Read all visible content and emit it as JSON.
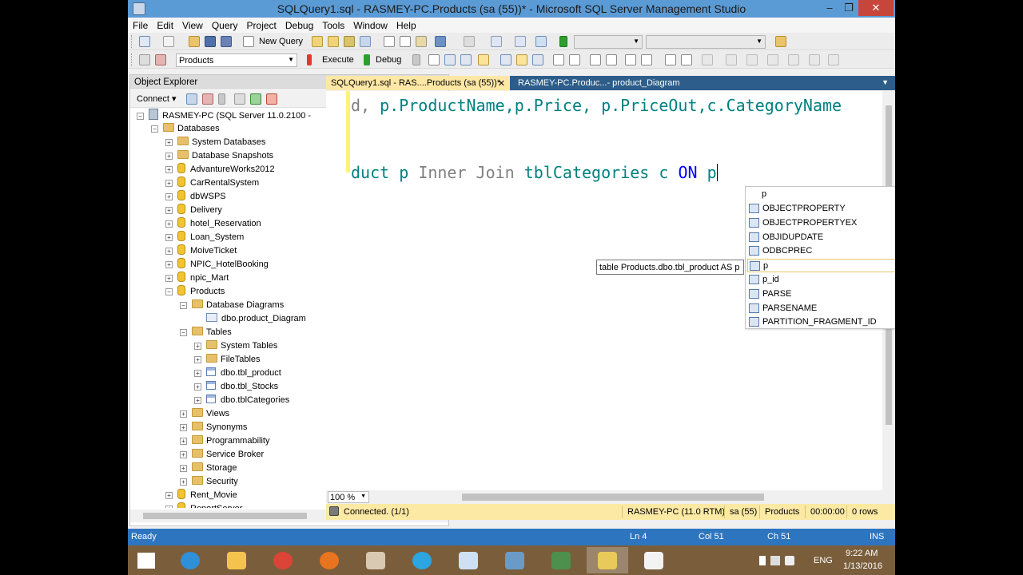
{
  "window": {
    "title": "SQLQuery1.sql - RASMEY-PC.Products (sa (55))* - Microsoft SQL Server Management Studio",
    "minimize": "–",
    "maximize": "❐",
    "close": "✕"
  },
  "menu": [
    "File",
    "Edit",
    "View",
    "Query",
    "Project",
    "Debug",
    "Tools",
    "Window",
    "Help"
  ],
  "toolbar1": {
    "new_query": "New Query"
  },
  "toolbar2": {
    "database": "Products",
    "execute": "Execute",
    "debug": "Debug"
  },
  "object_explorer": {
    "title": "Object Explorer",
    "pins": "▾ ⊥ ✕",
    "connect": "Connect ▾",
    "tree": [
      {
        "label": "RASMEY-PC (SQL Server 11.0.2100 -",
        "level": 0,
        "exp": "−",
        "icon": "server"
      },
      {
        "label": "Databases",
        "level": 1,
        "exp": "−",
        "icon": "folder"
      },
      {
        "label": "System Databases",
        "level": 2,
        "exp": "+",
        "icon": "folder"
      },
      {
        "label": "Database Snapshots",
        "level": 2,
        "exp": "+",
        "icon": "folder"
      },
      {
        "label": "AdvantureWorks2012",
        "level": 2,
        "exp": "+",
        "icon": "db"
      },
      {
        "label": "CarRentalSystem",
        "level": 2,
        "exp": "+",
        "icon": "db"
      },
      {
        "label": "dbWSPS",
        "level": 2,
        "exp": "+",
        "icon": "db"
      },
      {
        "label": "Delivery",
        "level": 2,
        "exp": "+",
        "icon": "db"
      },
      {
        "label": "hotel_Reservation",
        "level": 2,
        "exp": "+",
        "icon": "db"
      },
      {
        "label": "Loan_System",
        "level": 2,
        "exp": "+",
        "icon": "db"
      },
      {
        "label": "MoiveTicket",
        "level": 2,
        "exp": "+",
        "icon": "db"
      },
      {
        "label": "NPIC_HotelBooking",
        "level": 2,
        "exp": "+",
        "icon": "db"
      },
      {
        "label": "npic_Mart",
        "level": 2,
        "exp": "+",
        "icon": "db"
      },
      {
        "label": "Products",
        "level": 2,
        "exp": "−",
        "icon": "db"
      },
      {
        "label": "Database Diagrams",
        "level": 3,
        "exp": "−",
        "icon": "folder"
      },
      {
        "label": "dbo.product_Diagram",
        "level": 4,
        "exp": "",
        "icon": "diagram"
      },
      {
        "label": "Tables",
        "level": 3,
        "exp": "−",
        "icon": "folder"
      },
      {
        "label": "System Tables",
        "level": 4,
        "exp": "+",
        "icon": "folder"
      },
      {
        "label": "FileTables",
        "level": 4,
        "exp": "+",
        "icon": "folder"
      },
      {
        "label": "dbo.tbl_product",
        "level": 4,
        "exp": "+",
        "icon": "table"
      },
      {
        "label": "dbo.tbl_Stocks",
        "level": 4,
        "exp": "+",
        "icon": "table"
      },
      {
        "label": "dbo.tblCategories",
        "level": 4,
        "exp": "+",
        "icon": "table"
      },
      {
        "label": "Views",
        "level": 3,
        "exp": "+",
        "icon": "folder"
      },
      {
        "label": "Synonyms",
        "level": 3,
        "exp": "+",
        "icon": "folder"
      },
      {
        "label": "Programmability",
        "level": 3,
        "exp": "+",
        "icon": "folder"
      },
      {
        "label": "Service Broker",
        "level": 3,
        "exp": "+",
        "icon": "folder"
      },
      {
        "label": "Storage",
        "level": 3,
        "exp": "+",
        "icon": "folder"
      },
      {
        "label": "Security",
        "level": 3,
        "exp": "+",
        "icon": "folder"
      },
      {
        "label": "Rent_Movie",
        "level": 2,
        "exp": "+",
        "icon": "db"
      },
      {
        "label": "ReportServer",
        "level": 2,
        "exp": "+",
        "icon": "db"
      }
    ]
  },
  "tabs": {
    "active": "SQLQuery1.sql - RAS....Products (sa (55))*",
    "active_close": "✕",
    "inactive": "RASMEY-PC.Produc...- product_Diagram"
  },
  "editor": {
    "line1_prefix": "d, ",
    "line1": "p.ProductName,p.Price, p.PriceOut,c.CategoryName",
    "line2_a": "duct ",
    "line2_b": "p ",
    "line2_c": "Inner Join ",
    "line2_d": "tblCategories",
    "line2_e": " c ",
    "line2_f": "ON",
    "line2_g": " p",
    "zoom": "100 %"
  },
  "tooltip": "table Products.dbo.tbl_product AS p",
  "intellisense": {
    "typed": "p",
    "items": [
      {
        "label": "OBJECTPROPERTY",
        "selected": false
      },
      {
        "label": "OBJECTPROPERTYEX",
        "selected": false
      },
      {
        "label": "OBJIDUPDATE",
        "selected": false
      },
      {
        "label": "ODBCPREC",
        "selected": false
      },
      {
        "label": "p",
        "selected": true
      },
      {
        "label": "p_id",
        "selected": false
      },
      {
        "label": "PARSE",
        "selected": false
      },
      {
        "label": "PARSENAME",
        "selected": false
      },
      {
        "label": "PARTITION_FRAGMENT_ID",
        "selected": false
      }
    ]
  },
  "query_status": {
    "connected": "Connected. (1/1)",
    "server": "RASMEY-PC (11.0 RTM)",
    "user": "sa (55)",
    "database": "Products",
    "time": "00:00:00",
    "rows": "0 rows"
  },
  "statusbar": {
    "ready": "Ready",
    "ln": "Ln 4",
    "col": "Col 51",
    "ch": "Ch 51",
    "ins": "INS"
  },
  "taskbar": {
    "lang": "ENG",
    "time": "9:22 AM",
    "date": "1/13/2016"
  },
  "colors": {
    "accent": "#2e75bf",
    "titlebar": "#5b9bd5",
    "query_status": "#fbe9a4"
  }
}
